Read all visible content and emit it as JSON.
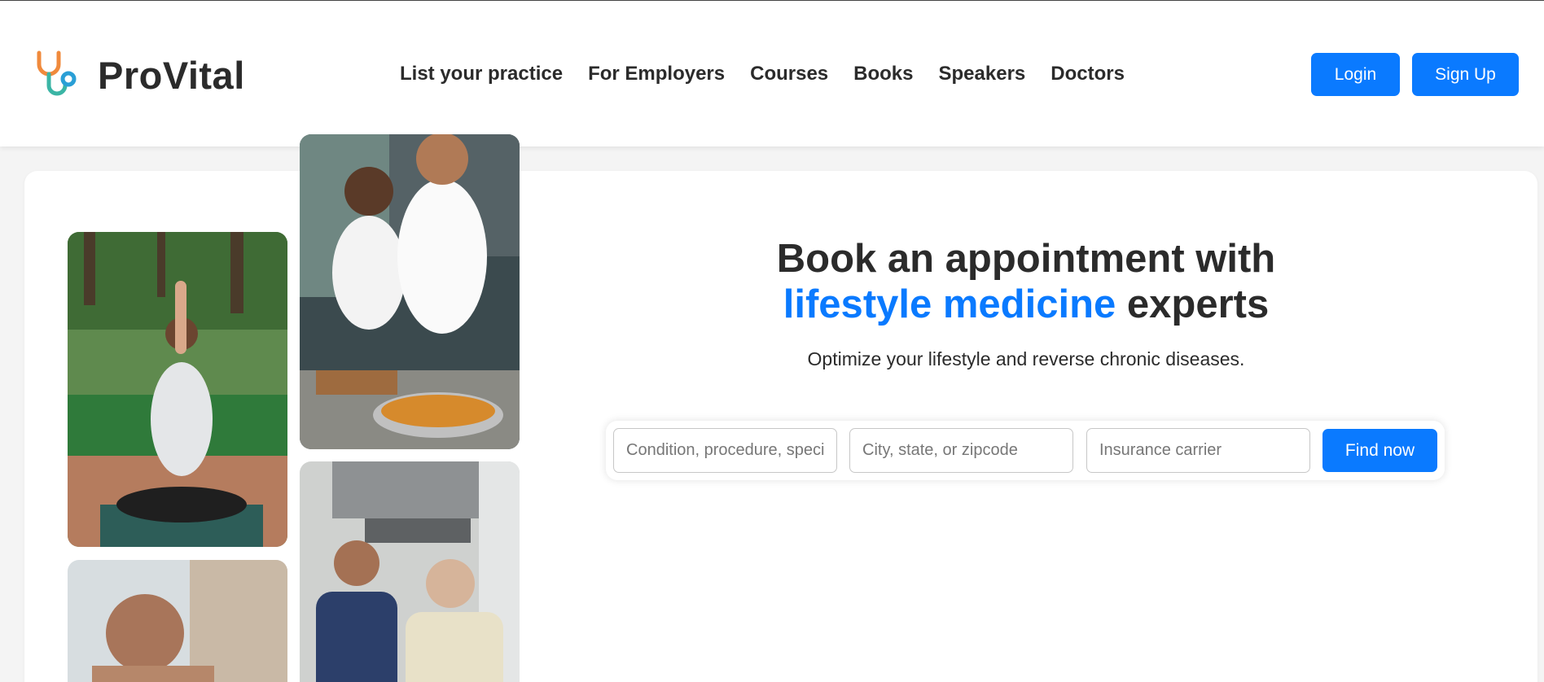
{
  "brand": {
    "name": "ProVital",
    "icon": "stethoscope-icon"
  },
  "nav": {
    "items": [
      {
        "label": "List your practice"
      },
      {
        "label": "For Employers"
      },
      {
        "label": "Courses"
      },
      {
        "label": "Books"
      },
      {
        "label": "Speakers"
      },
      {
        "label": "Doctors"
      }
    ]
  },
  "auth": {
    "login_label": "Login",
    "signup_label": "Sign Up"
  },
  "hero": {
    "title_line1": "Book an appointment with",
    "title_accent": "lifestyle medicine",
    "title_end": " experts",
    "subtitle": "Optimize your lifestyle and reverse chronic diseases."
  },
  "search": {
    "condition_placeholder": "Condition, procedure, speciality",
    "location_placeholder": "City, state, or zipcode",
    "insurance_placeholder": "Insurance carrier",
    "find_label": "Find now"
  },
  "colors": {
    "accent": "#0a7aff",
    "text": "#2b2b2b",
    "background": "#f4f4f4"
  }
}
